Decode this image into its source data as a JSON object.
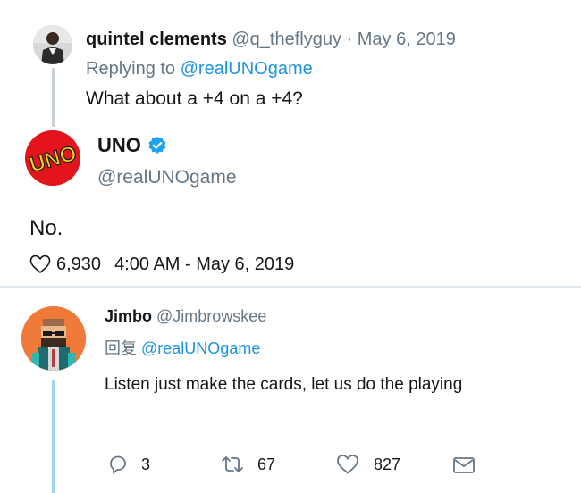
{
  "tweet1": {
    "author_name": "quintel clements",
    "author_handle": "@q_theflyguy",
    "date": "· May 6, 2019",
    "replying_prefix": "Replying to",
    "replying_to": "@realUNOgame",
    "text": "What about a +4 on a +4?"
  },
  "tweet2": {
    "author_name": "UNO",
    "author_handle": "@realUNOgame",
    "logo_text": "UNO",
    "text": "No.",
    "likes": "6,930",
    "timestamp": "4:00 AM - May 6, 2019"
  },
  "tweet3": {
    "author_name": "Jimbo",
    "author_handle": "@Jimbrowskee",
    "replying_prefix": "回复",
    "replying_to": "@realUNOgame",
    "text": "Listen just make the cards, let us do the playing",
    "replies": "3",
    "retweets": "67",
    "likes": "827"
  },
  "colors": {
    "link": "#1b95e0",
    "muted": "#657786",
    "verified": "#1da1f2",
    "uno_red": "#e3141b",
    "uno_yellow": "#f7d117",
    "thread_line": "#c9d2d9",
    "thread_line_blue": "#9fd4f5"
  },
  "icons": {
    "verified": "verified-badge-icon",
    "like": "heart-icon",
    "reply": "reply-icon",
    "retweet": "retweet-icon",
    "dm": "envelope-icon"
  }
}
